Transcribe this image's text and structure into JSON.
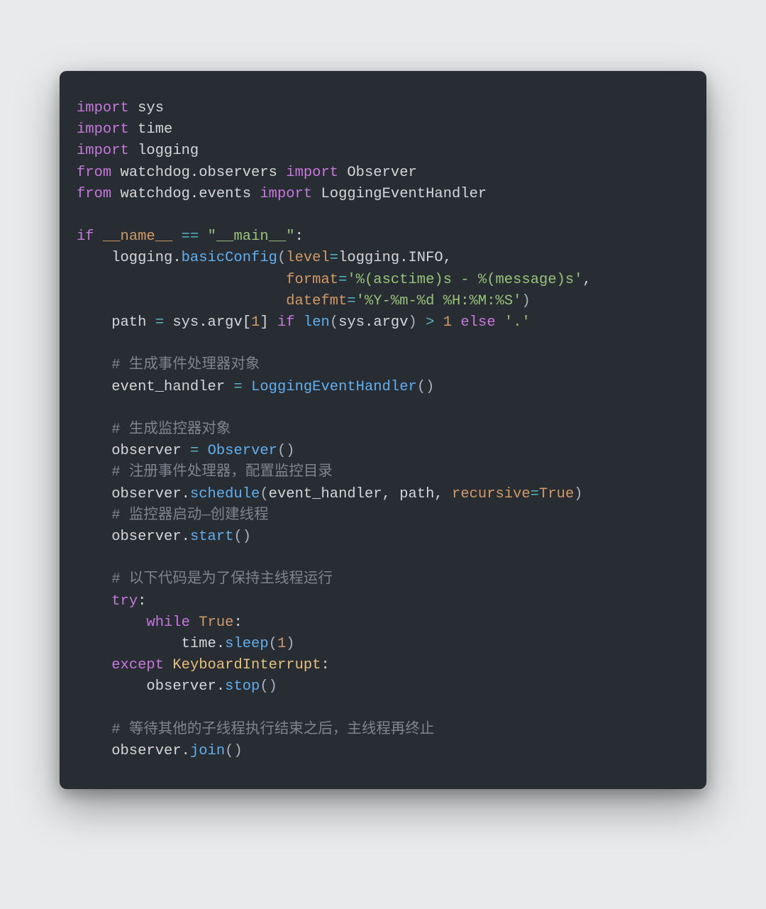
{
  "code": {
    "lines": [
      [
        [
          "kw",
          "import"
        ],
        [
          "plain",
          " sys"
        ]
      ],
      [
        [
          "kw",
          "import"
        ],
        [
          "plain",
          " time"
        ]
      ],
      [
        [
          "kw",
          "import"
        ],
        [
          "plain",
          " logging"
        ]
      ],
      [
        [
          "kw",
          "from"
        ],
        [
          "plain",
          " watchdog.observers "
        ],
        [
          "kw",
          "import"
        ],
        [
          "plain",
          " Observer"
        ]
      ],
      [
        [
          "kw",
          "from"
        ],
        [
          "plain",
          " watchdog.events "
        ],
        [
          "kw",
          "import"
        ],
        [
          "plain",
          " LoggingEventHandler"
        ]
      ],
      [
        [
          "plain",
          ""
        ]
      ],
      [
        [
          "kw",
          "if"
        ],
        [
          "plain",
          " "
        ],
        [
          "dun",
          "__name__"
        ],
        [
          "plain",
          " "
        ],
        [
          "op",
          "=="
        ],
        [
          "plain",
          " "
        ],
        [
          "str",
          "\"__main__\""
        ],
        [
          "plain",
          ":"
        ]
      ],
      [
        [
          "plain",
          "    logging."
        ],
        [
          "func",
          "basicConfig"
        ],
        [
          "punc",
          "("
        ],
        [
          "param",
          "level"
        ],
        [
          "op",
          "="
        ],
        [
          "plain",
          "logging.INFO,"
        ]
      ],
      [
        [
          "plain",
          "                        "
        ],
        [
          "param",
          "format"
        ],
        [
          "op",
          "="
        ],
        [
          "str",
          "'%(asctime)s - %(message)s'"
        ],
        [
          "plain",
          ","
        ]
      ],
      [
        [
          "plain",
          "                        "
        ],
        [
          "param",
          "datefmt"
        ],
        [
          "op",
          "="
        ],
        [
          "str",
          "'%Y-%m-%d %H:%M:%S'"
        ],
        [
          "punc",
          ")"
        ]
      ],
      [
        [
          "plain",
          "    path "
        ],
        [
          "op",
          "="
        ],
        [
          "plain",
          " sys.argv["
        ],
        [
          "num",
          "1"
        ],
        [
          "plain",
          "] "
        ],
        [
          "kw",
          "if"
        ],
        [
          "plain",
          " "
        ],
        [
          "func",
          "len"
        ],
        [
          "punc",
          "("
        ],
        [
          "plain",
          "sys.argv"
        ],
        [
          "punc",
          ")"
        ],
        [
          "plain",
          " "
        ],
        [
          "op",
          ">"
        ],
        [
          "plain",
          " "
        ],
        [
          "num",
          "1"
        ],
        [
          "plain",
          " "
        ],
        [
          "kw",
          "else"
        ],
        [
          "plain",
          " "
        ],
        [
          "str",
          "'.'"
        ]
      ],
      [
        [
          "plain",
          ""
        ]
      ],
      [
        [
          "plain",
          "    "
        ],
        [
          "cmt",
          "# 生成事件处理器对象"
        ]
      ],
      [
        [
          "plain",
          "    event_handler "
        ],
        [
          "op",
          "="
        ],
        [
          "plain",
          " "
        ],
        [
          "func",
          "LoggingEventHandler"
        ],
        [
          "punc",
          "()"
        ]
      ],
      [
        [
          "plain",
          ""
        ]
      ],
      [
        [
          "plain",
          "    "
        ],
        [
          "cmt",
          "# 生成监控器对象"
        ]
      ],
      [
        [
          "plain",
          "    observer "
        ],
        [
          "op",
          "="
        ],
        [
          "plain",
          " "
        ],
        [
          "func",
          "Observer"
        ],
        [
          "punc",
          "()"
        ]
      ],
      [
        [
          "plain",
          "    "
        ],
        [
          "cmt",
          "# 注册事件处理器，配置监控目录"
        ]
      ],
      [
        [
          "plain",
          "    observer."
        ],
        [
          "func",
          "schedule"
        ],
        [
          "punc",
          "("
        ],
        [
          "plain",
          "event_handler, path, "
        ],
        [
          "param",
          "recursive"
        ],
        [
          "op",
          "="
        ],
        [
          "bool",
          "True"
        ],
        [
          "punc",
          ")"
        ]
      ],
      [
        [
          "plain",
          "    "
        ],
        [
          "cmt",
          "# 监控器启动—创建线程"
        ]
      ],
      [
        [
          "plain",
          "    observer."
        ],
        [
          "func",
          "start"
        ],
        [
          "punc",
          "()"
        ]
      ],
      [
        [
          "plain",
          ""
        ]
      ],
      [
        [
          "plain",
          "    "
        ],
        [
          "cmt",
          "# 以下代码是为了保持主线程运行"
        ]
      ],
      [
        [
          "plain",
          "    "
        ],
        [
          "kw",
          "try"
        ],
        [
          "plain",
          ":"
        ]
      ],
      [
        [
          "plain",
          "        "
        ],
        [
          "kw",
          "while"
        ],
        [
          "plain",
          " "
        ],
        [
          "bool",
          "True"
        ],
        [
          "plain",
          ":"
        ]
      ],
      [
        [
          "plain",
          "            time."
        ],
        [
          "func",
          "sleep"
        ],
        [
          "punc",
          "("
        ],
        [
          "num",
          "1"
        ],
        [
          "punc",
          ")"
        ]
      ],
      [
        [
          "plain",
          "    "
        ],
        [
          "kw",
          "except"
        ],
        [
          "plain",
          " "
        ],
        [
          "cls",
          "KeyboardInterrupt"
        ],
        [
          "plain",
          ":"
        ]
      ],
      [
        [
          "plain",
          "        observer."
        ],
        [
          "func",
          "stop"
        ],
        [
          "punc",
          "()"
        ]
      ],
      [
        [
          "plain",
          ""
        ]
      ],
      [
        [
          "plain",
          "    "
        ],
        [
          "cmt",
          "# 等待其他的子线程执行结束之后，主线程再终止"
        ]
      ],
      [
        [
          "plain",
          "    observer."
        ],
        [
          "func",
          "join"
        ],
        [
          "punc",
          "()"
        ]
      ]
    ]
  },
  "colors": {
    "background": "#e8eaec",
    "card": "#282c33",
    "keyword": "#c678dd",
    "string": "#98c379",
    "function": "#61afef",
    "param": "#d19a66",
    "comment": "#7f848e",
    "operator": "#56b6c2",
    "class": "#e5c07b",
    "default": "#d6d6d6"
  }
}
